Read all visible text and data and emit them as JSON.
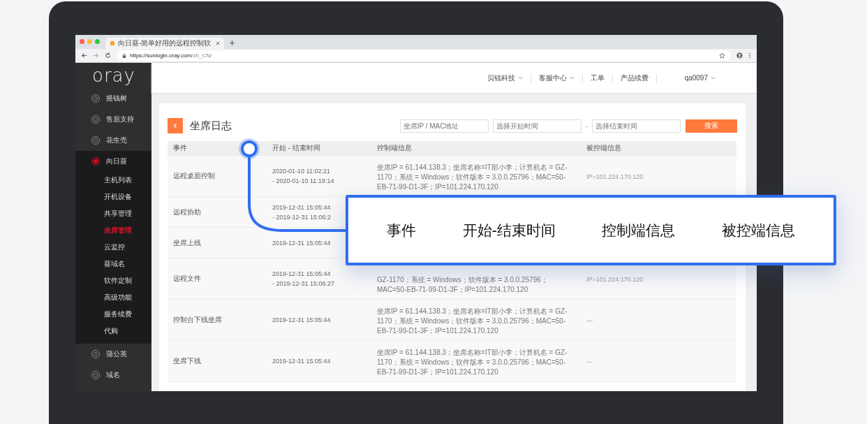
{
  "browser": {
    "tab_title": "向日葵-简单好用的远程控制软",
    "url_host": "https://sunlogin.oray.com",
    "url_path": "/zh_CN/"
  },
  "sidebar": {
    "logo": "oray",
    "items": [
      {
        "label": "摇钱树",
        "expanded": false
      },
      {
        "label": "售后支持",
        "expanded": false
      },
      {
        "label": "花生壳",
        "expanded": false
      },
      {
        "label": "向日葵",
        "expanded": true,
        "children": [
          {
            "label": "主机列表",
            "selected": false
          },
          {
            "label": "开机设备",
            "selected": false
          },
          {
            "label": "共享管理",
            "selected": false
          },
          {
            "label": "坐席管理",
            "selected": true
          },
          {
            "label": "云监控",
            "selected": false
          },
          {
            "label": "葵域名",
            "selected": false
          },
          {
            "label": "软件定制",
            "selected": false
          },
          {
            "label": "高级功能",
            "selected": false
          },
          {
            "label": "服务续费",
            "selected": false
          },
          {
            "label": "代购",
            "selected": false
          }
        ]
      },
      {
        "label": "蒲公英",
        "expanded": false
      },
      {
        "label": "域名",
        "expanded": false
      }
    ]
  },
  "header_menu": [
    {
      "label": "贝锐科技",
      "dropdown": true
    },
    {
      "label": "客服中心",
      "dropdown": true
    },
    {
      "label": "工单",
      "dropdown": false
    },
    {
      "label": "产品续费",
      "dropdown": false
    },
    {
      "label": "qa0097",
      "dropdown": true
    }
  ],
  "page": {
    "title": "坐席日志",
    "filters": [
      {
        "placeholder": "坐席IP / MAC地址"
      },
      {
        "placeholder": "选择开始时间"
      },
      {
        "placeholder": "选择结束时间"
      }
    ],
    "range_separator": "-",
    "search_button": "搜索"
  },
  "table": {
    "columns": [
      "事件",
      "开始 - 结束时间",
      "控制端信息",
      "被控端信息"
    ],
    "rows": [
      {
        "event": "远程桌面控制",
        "time": [
          "2020-01-10 11:02:21",
          "- 2020-01-10 11:19:14"
        ],
        "controller": "坐席IP = 61.144.138.3；坐席名称=IT部小李；计算机名 = GZ-1170；系统 = Windows；软件版本 = 3.0.0.25796；MAC=50-EB-71-99-D1-3F；IP=101.224.170.120",
        "controlled": "IP=101.224.170.120"
      },
      {
        "event": "远程协助",
        "time": [
          "2019-12-31 15:05:44",
          "- 2019-12-31 15:06:2"
        ]
      },
      {
        "event": "坐席上线",
        "time": [
          "2019-12-31 15:05:44"
        ]
      },
      {
        "event": "远程文件",
        "time": [
          "2019-12-31 15:05:44",
          "- 2019-12-31 15:06:27"
        ],
        "controller": "GZ-1170；系统 = Windows；软件版本 = 3.0.0.25796；MAC=50-EB-71-99-D1-3F；IP=101.224.170.120",
        "controlled": "IP=101.224.170.120"
      },
      {
        "event": "控制台下线坐席",
        "time": [
          "2019-12-31 15:05:44"
        ],
        "controller": "坐席IP = 61.144.138.3；坐席名称=IT部小李；计算机名 = GZ-1170；系统 = Windows；软件版本 = 3.0.0.25796；MAC=50-EB-71-99-D1-3F；IP=101.224.170.120",
        "controlled": "—"
      },
      {
        "event": "坐席下线",
        "time": [
          "2019-12-31 15:05:44"
        ],
        "controller": "坐席IP = 61.144.138.3；坐席名称=IT部小李；计算机名 = GZ-1170；系统 = Windows；软件版本 = 3.0.0.25796；MAC=50-EB-71-99-D1-3F；IP=101.224.170.120",
        "controlled": "—"
      }
    ]
  },
  "callout": {
    "labels": [
      "事件",
      "开始-结束时间",
      "控制端信息",
      "被控端信息"
    ]
  }
}
